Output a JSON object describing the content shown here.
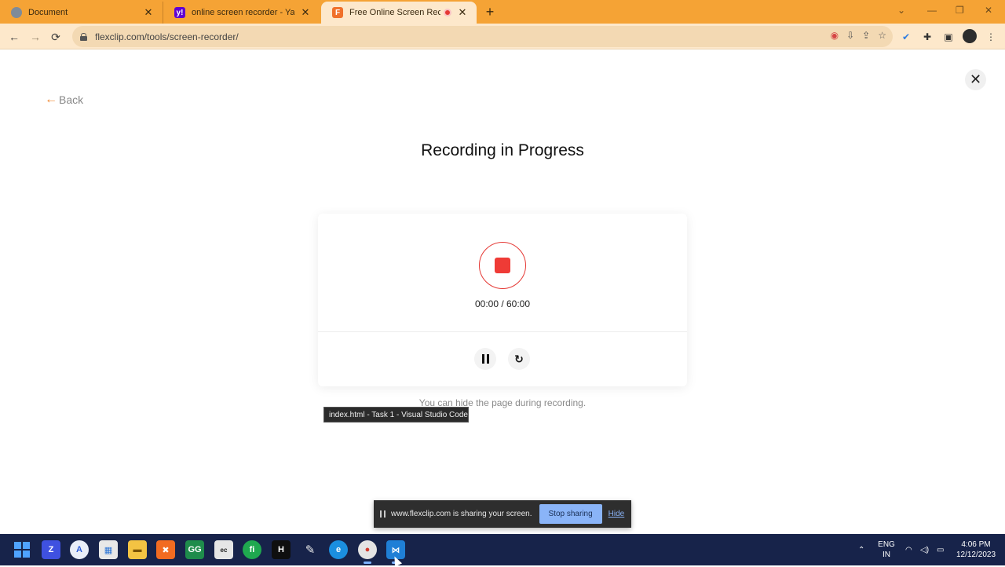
{
  "browser": {
    "tabs": [
      {
        "title": "Document",
        "favicon": "globe-icon"
      },
      {
        "title": "online screen recorder - Yahoo",
        "favicon": "yahoo-icon"
      },
      {
        "title": "Free Online Screen Recorde",
        "favicon": "flexclip-icon",
        "recording": true
      }
    ],
    "url": "flexclip.com/tools/screen-recorder/"
  },
  "page": {
    "back_label": "Back",
    "heading": "Recording in Progress",
    "timer": "00:00 / 60:00",
    "hint": "You can hide the page during recording.",
    "tooltip": "index.html - Task 1 - Visual Studio Code"
  },
  "share_bar": {
    "text": "www.flexclip.com is sharing your screen.",
    "stop_label": "Stop sharing",
    "hide_label": "Hide"
  },
  "taskbar": {
    "lang_line1": "ENG",
    "lang_line2": "IN",
    "time": "4:06 PM",
    "date": "12/12/2023"
  },
  "colors": {
    "tabstrip": "#f5a335",
    "toolbar": "#fde8cb",
    "record_red": "#ef3b36",
    "accent_orange": "#f08a35",
    "taskbar": "#17234a"
  }
}
